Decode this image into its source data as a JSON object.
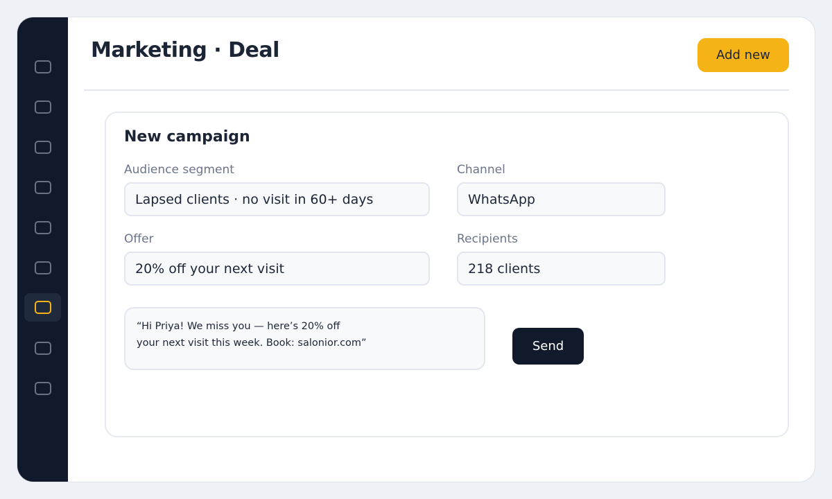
{
  "header": {
    "title": "Marketing · Deal",
    "add_label": "Add new"
  },
  "sidebar": {
    "items": [
      {
        "icon": "nav-icon",
        "active": false
      },
      {
        "icon": "nav-icon",
        "active": false
      },
      {
        "icon": "nav-icon",
        "active": false
      },
      {
        "icon": "nav-icon",
        "active": false
      },
      {
        "icon": "nav-icon",
        "active": false
      },
      {
        "icon": "nav-icon",
        "active": false
      },
      {
        "icon": "nav-icon",
        "active": true
      },
      {
        "icon": "nav-icon",
        "active": false
      },
      {
        "icon": "nav-icon",
        "active": false
      }
    ]
  },
  "campaign": {
    "title": "New campaign",
    "audience": {
      "label": "Audience segment",
      "value": "Lapsed clients · no visit in 60+ days"
    },
    "channel": {
      "label": "Channel",
      "value": "WhatsApp"
    },
    "offer": {
      "label": "Offer",
      "value": "20% off your next visit"
    },
    "recipients": {
      "label": "Recipients",
      "value": "218 clients"
    },
    "message": {
      "line1": "“Hi Priya! We miss you — here’s 20% off",
      "line2": "your next visit this week. Book: salonior.com”"
    },
    "send_label": "Send"
  },
  "colors": {
    "sidebar_bg": "#111a2b",
    "accent": "#f5b316",
    "text": "#1c2536",
    "muted": "#6b7488"
  }
}
